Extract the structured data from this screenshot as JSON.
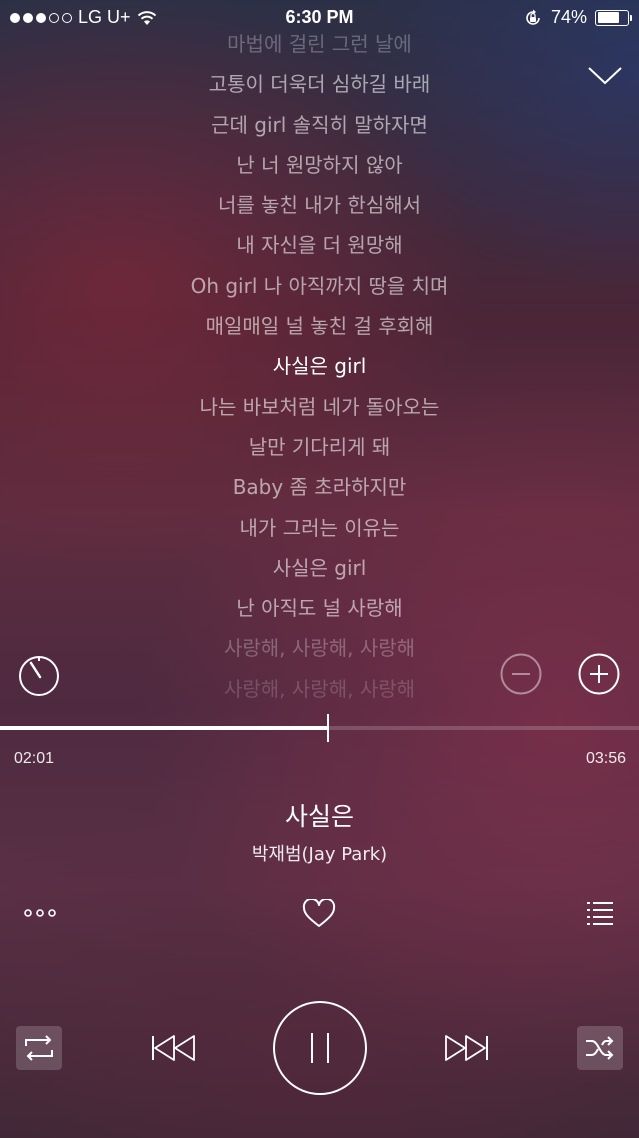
{
  "status_bar": {
    "carrier": "LG U+",
    "time": "6:30 PM",
    "battery_percent": "74%",
    "battery_level": 0.74,
    "signal_bars_filled": 3,
    "signal_bars_total": 5
  },
  "lyrics": [
    {
      "text": "마법에 걸린 그런 날에",
      "state": "fade1"
    },
    {
      "text": "고통이 더욱더 심하길 바래",
      "state": "normal"
    },
    {
      "text": "근데 girl 솔직히 말하자면",
      "state": "normal"
    },
    {
      "text": "난 너 원망하지 않아",
      "state": "normal"
    },
    {
      "text": "너를 놓친 내가 한심해서",
      "state": "normal"
    },
    {
      "text": "내 자신을 더 원망해",
      "state": "normal"
    },
    {
      "text": "Oh girl 나 아직까지 땅을 치며",
      "state": "normal"
    },
    {
      "text": "매일매일 널 놓친 걸 후회해",
      "state": "normal"
    },
    {
      "text": "사실은 girl",
      "state": "current"
    },
    {
      "text": "나는 바보처럼 네가 돌아오는",
      "state": "normal"
    },
    {
      "text": "날만 기다리게 돼",
      "state": "normal"
    },
    {
      "text": "Baby 좀 초라하지만",
      "state": "normal"
    },
    {
      "text": "내가 그러는 이유는",
      "state": "normal"
    },
    {
      "text": "사실은 girl",
      "state": "normal"
    },
    {
      "text": "난 아직도 널 사랑해",
      "state": "normal"
    },
    {
      "text": "사랑해, 사랑해, 사랑해",
      "state": "fade1"
    },
    {
      "text": "사랑해, 사랑해, 사랑해",
      "state": "fade2"
    }
  ],
  "player": {
    "elapsed": "02:01",
    "duration": "03:56",
    "progress_fraction": 0.513,
    "title": "사실은",
    "artist": "박재범(Jay Park)"
  },
  "icons": {
    "collapse": "chevron-down-icon",
    "timer": "timer-icon",
    "font_smaller": "minus-circle-icon",
    "font_larger": "plus-circle-icon",
    "more": "more-dots-icon",
    "like": "heart-icon",
    "playlist": "playlist-icon",
    "repeat": "repeat-icon",
    "previous": "previous-icon",
    "pause": "pause-icon",
    "next": "next-icon",
    "shuffle": "shuffle-icon"
  }
}
